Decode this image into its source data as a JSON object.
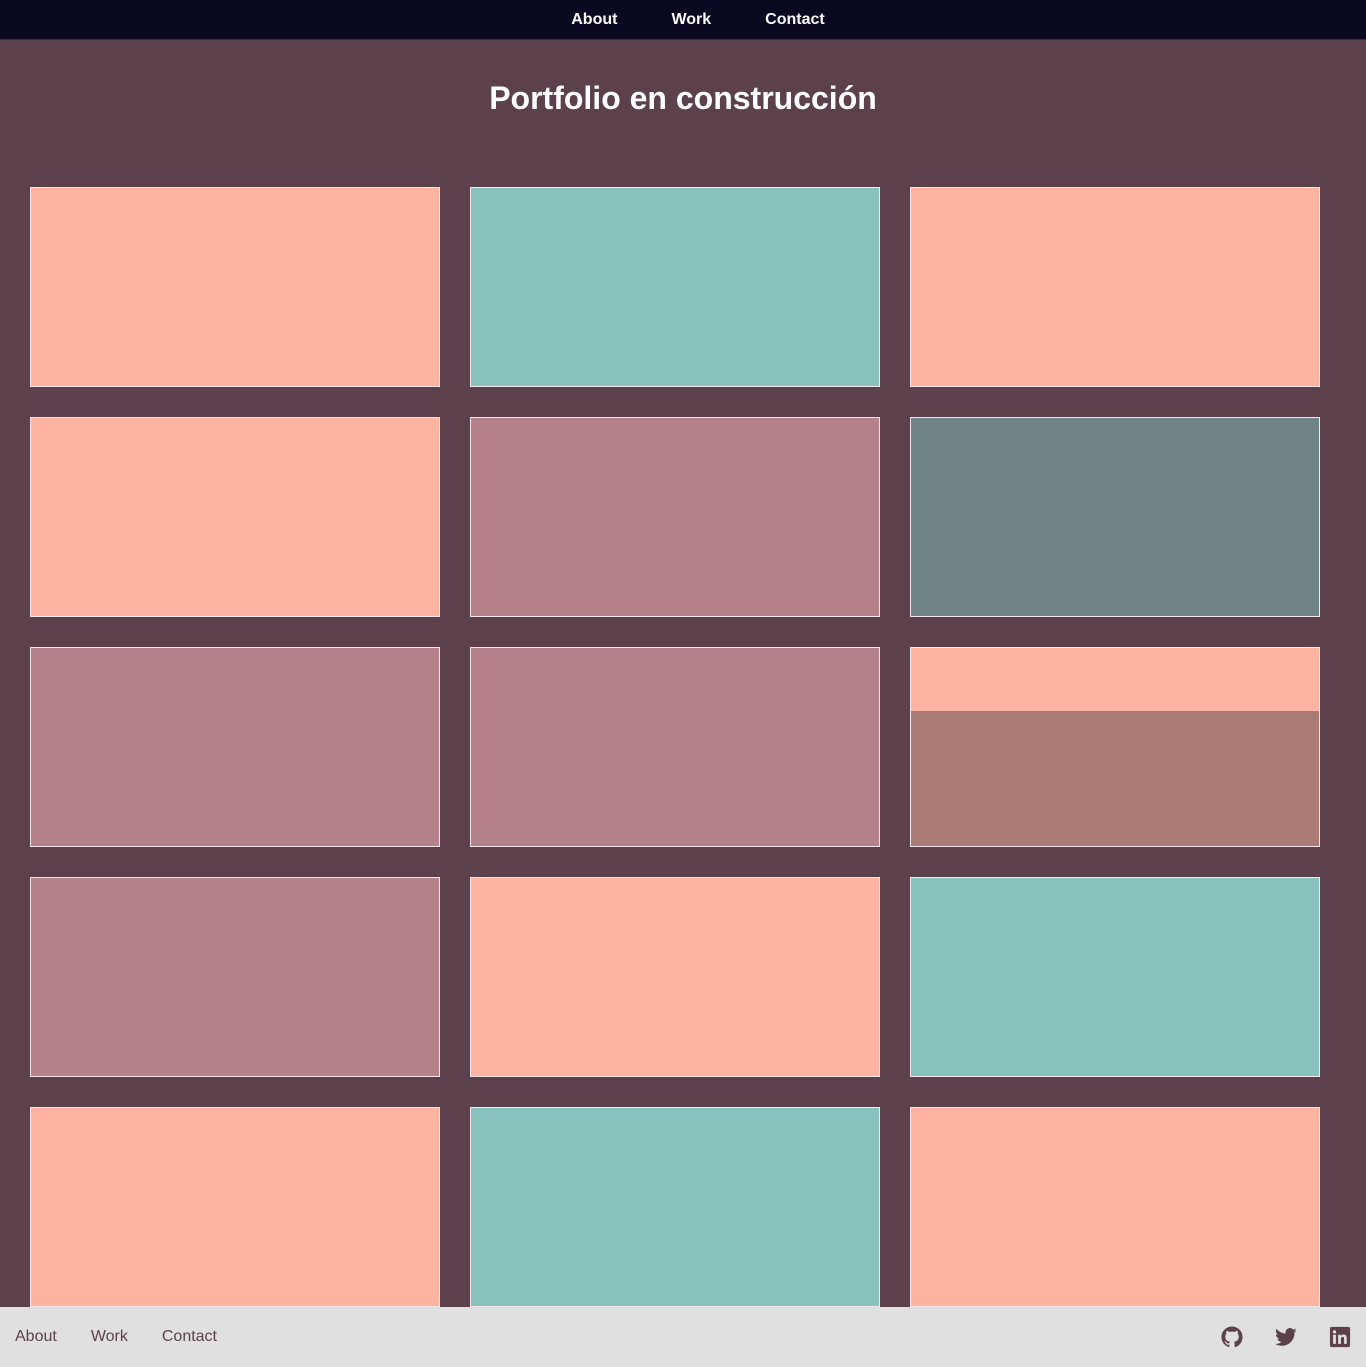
{
  "nav": {
    "items": [
      {
        "label": "About"
      },
      {
        "label": "Work"
      },
      {
        "label": "Contact"
      }
    ]
  },
  "page": {
    "title": "Portfolio en construcción"
  },
  "colors": {
    "background": "#5c414c",
    "nav_bg": "#090a22",
    "footer_bg": "#e0e0e2",
    "peach": "#ffb3a0",
    "teal": "#88c2bd",
    "mauve": "#b5828c",
    "slate": "#6f8286",
    "rose_overlay": "#ab7b75"
  },
  "grid": {
    "cards": [
      {
        "color": "#ffb3a0"
      },
      {
        "color": "#88c2bd"
      },
      {
        "color": "#ffb3a0"
      },
      {
        "color": "#ffb3a0"
      },
      {
        "color": "#b5828c"
      },
      {
        "color": "#6f8286"
      },
      {
        "color": "#b5828c"
      },
      {
        "color": "#b5828c"
      },
      {
        "color": "#ffb3a0",
        "overlay": "#ab7b75"
      },
      {
        "color": "#b5828c"
      },
      {
        "color": "#ffb3a0"
      },
      {
        "color": "#88c2bd"
      },
      {
        "color": "#ffb3a0"
      },
      {
        "color": "#88c2bd"
      },
      {
        "color": "#ffb3a0"
      }
    ]
  },
  "footer": {
    "links": [
      {
        "label": "About"
      },
      {
        "label": "Work"
      },
      {
        "label": "Contact"
      }
    ],
    "social": [
      {
        "icon": "github-icon"
      },
      {
        "icon": "twitter-icon"
      },
      {
        "icon": "linkedin-icon"
      }
    ]
  }
}
